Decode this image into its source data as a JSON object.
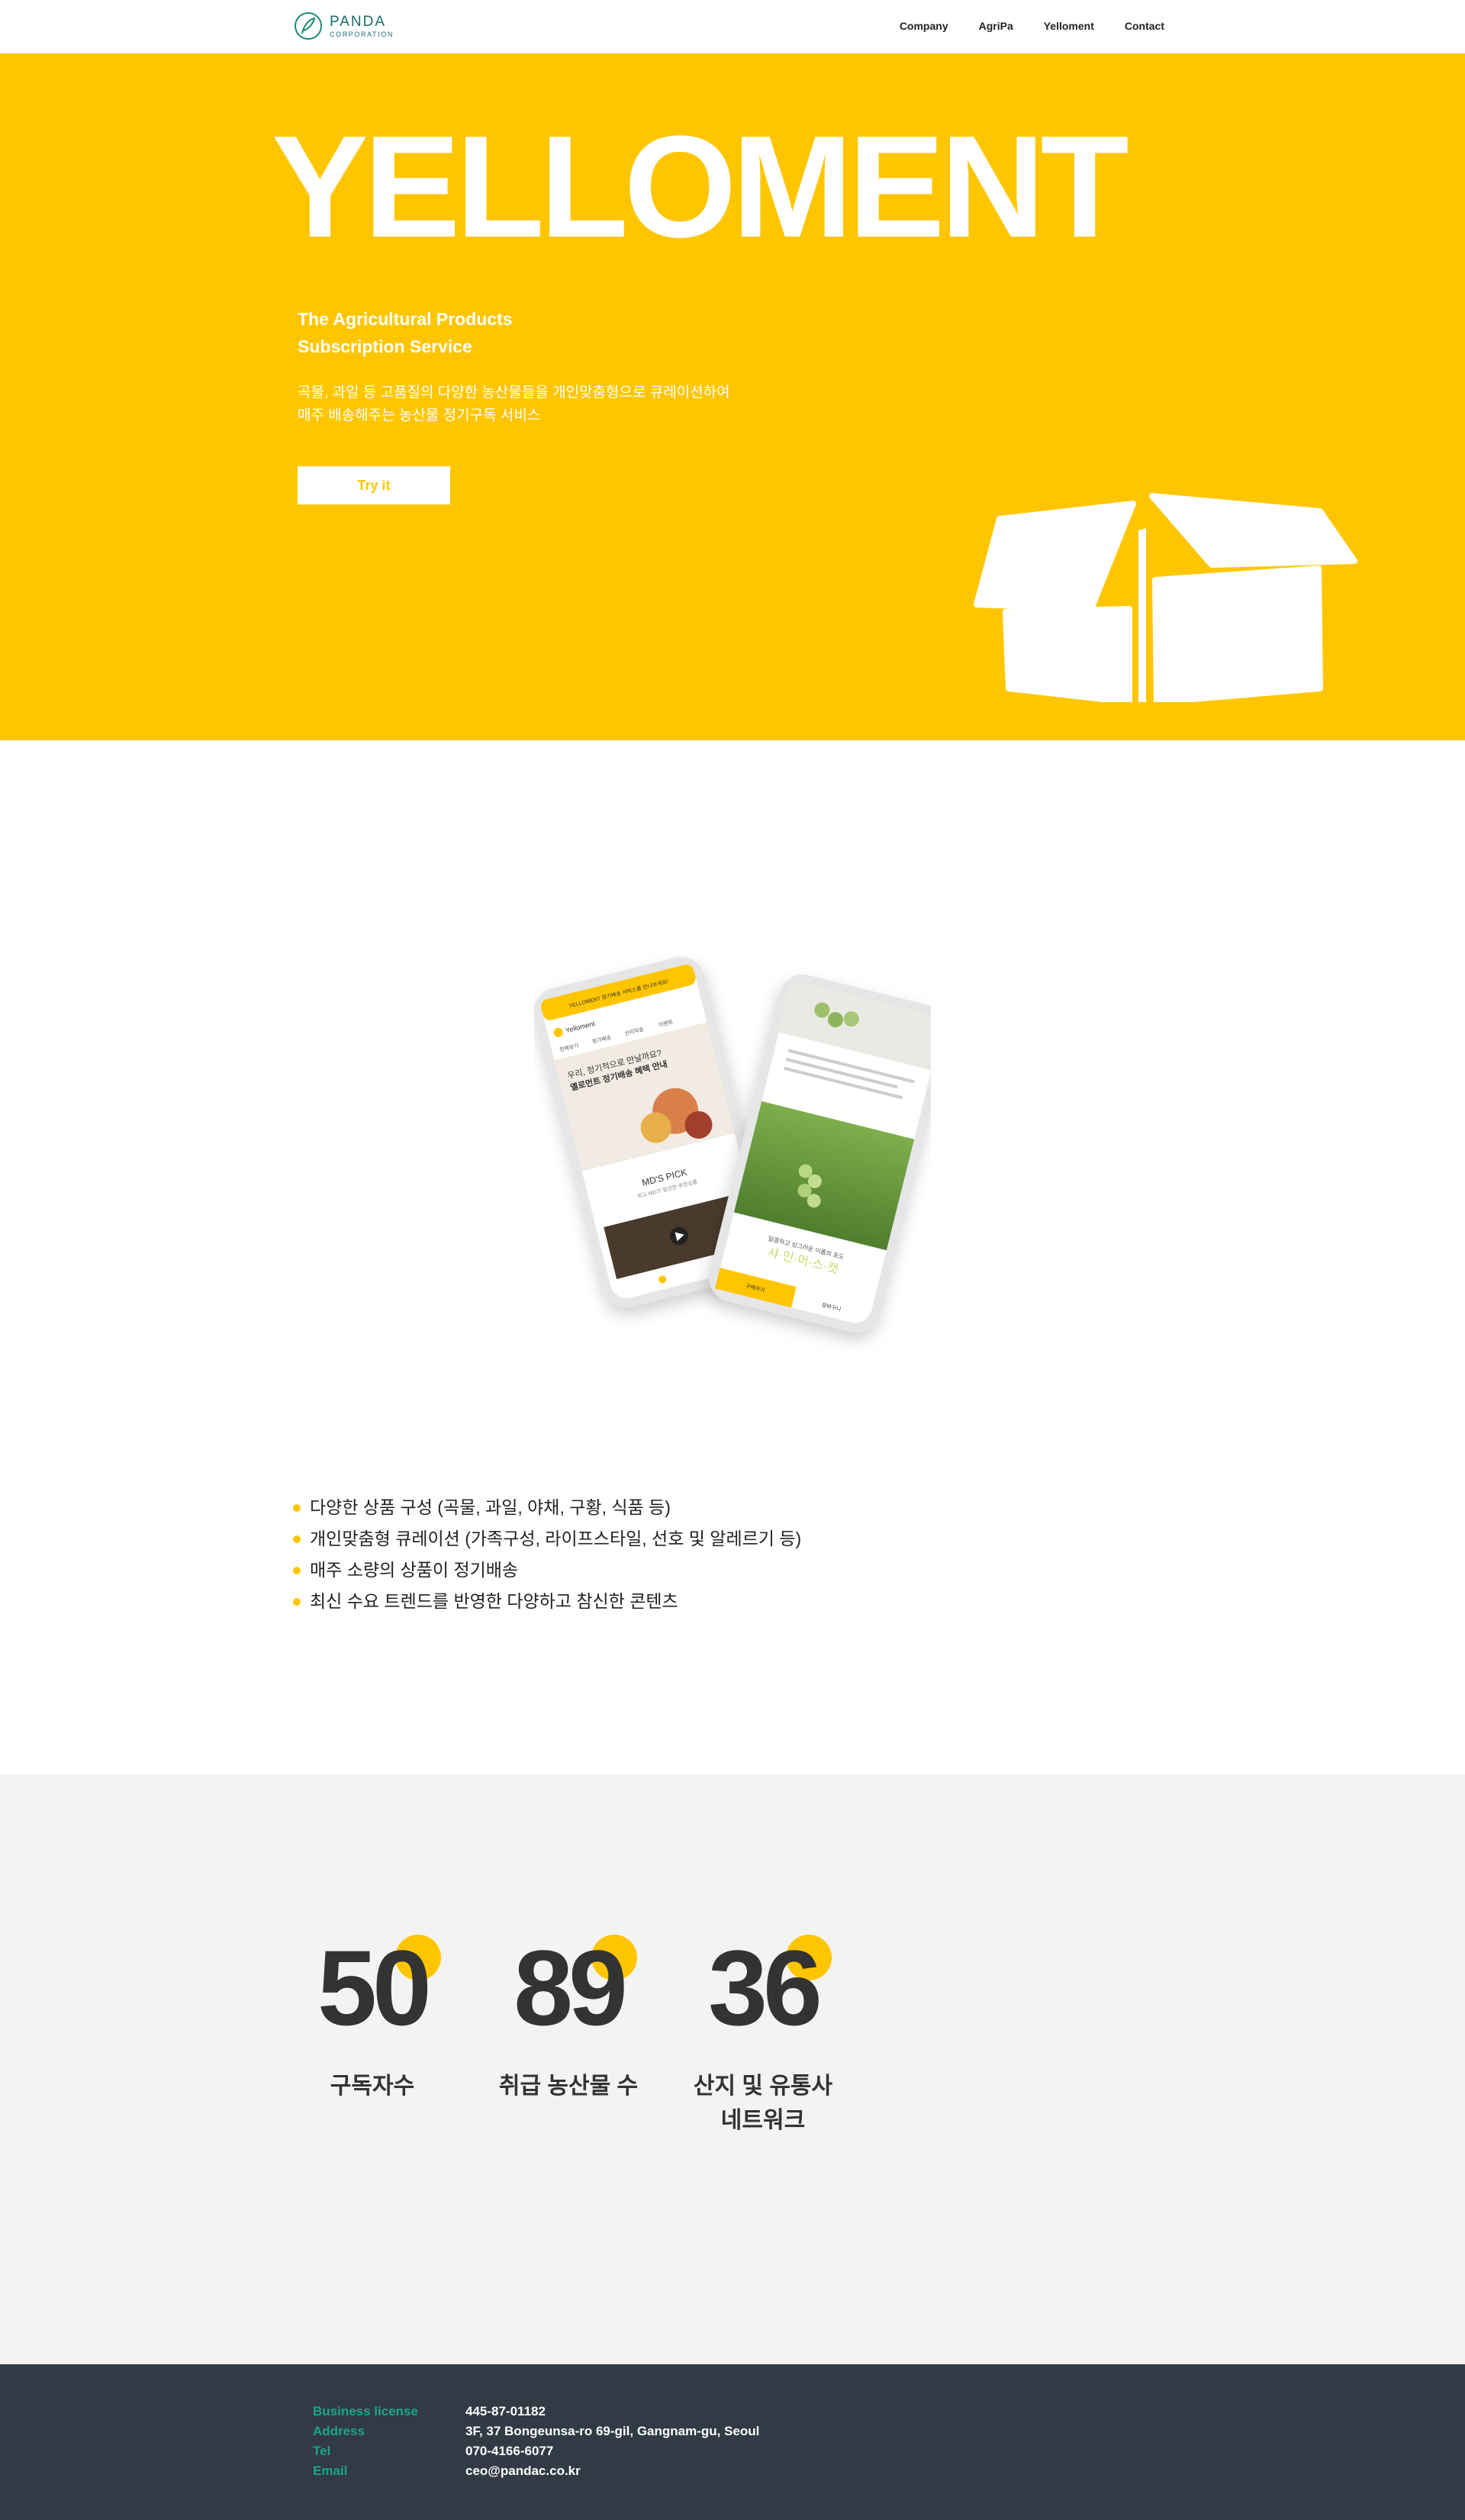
{
  "header": {
    "logo": {
      "name": "PANDA",
      "sub": "CORPORATION"
    },
    "nav": [
      "Company",
      "AgriPa",
      "Yelloment",
      "Contact"
    ]
  },
  "hero": {
    "title": "YELLOMENT",
    "subtitle_line1": "The Agricultural Products",
    "subtitle_line2": "Subscription Service",
    "desc_line1": "곡물, 과일 등 고품질의 다양한 농산물들을 개인맞춤형으로 큐레이션하여",
    "desc_line2": "매주 배송해주는 농산물 정기구독 서비스",
    "cta": "Try it",
    "accent": "#ffc600"
  },
  "phones": {
    "left_screen": {
      "banner": "YELLOMENT 정기배송 서비스를 만나보세요!",
      "brand": "Yelloment",
      "tabs": [
        "전체보기",
        "정기배송",
        "산지직송",
        "이벤트"
      ],
      "headline1": "우리, 정기적으로 만날까요?",
      "headline2": "옐로먼트 정기배송 혜택 안내",
      "section": "MD'S PICK",
      "section_sub": "최고 MD가 엄선한 추천상품"
    },
    "right_screen": {
      "caption": "달콤하고 싱그러운 이름의 포도",
      "product": "샤·인·머·스·캣",
      "btn_left": "구매하기",
      "btn_right": "장바구니"
    }
  },
  "features": [
    "다양한 상품 구성 (곡물, 과일, 야채, 구황, 식품 등)",
    "개인맞춤형 큐레이션 (가족구성, 라이프스타일, 선호 및 알레르기 등)",
    "매주 소량의 상품이 정기배송",
    "최신 수요 트렌드를 반영한 다양하고 참신한 콘텐츠"
  ],
  "stats": [
    {
      "value": "50",
      "label_line1": "구독자수",
      "label_line2": ""
    },
    {
      "value": "89",
      "label_line1": "취급 농산물 수",
      "label_line2": ""
    },
    {
      "value": "36",
      "label_line1": "산지 및 유통사",
      "label_line2": "네트워크"
    }
  ],
  "footer": {
    "business_license": {
      "key": "Business license",
      "value": "445-87-01182"
    },
    "address": {
      "key": "Address",
      "value": "3F, 37 Bongeunsa-ro 69-gil, Gangnam-gu, Seoul"
    },
    "tel": {
      "key": "Tel",
      "value": "070-4166-6077"
    },
    "email": {
      "key": "Email",
      "value": "ceo@pandac.co.kr"
    }
  }
}
